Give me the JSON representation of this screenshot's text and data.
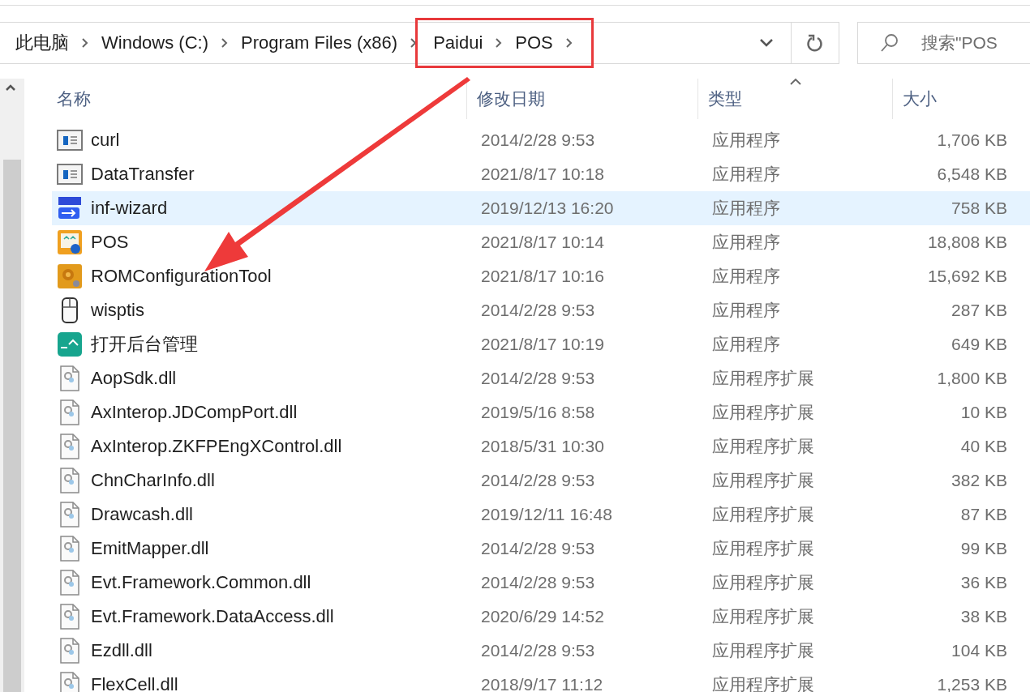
{
  "address_bar": {
    "crumbs": [
      {
        "label": "此电脑",
        "highlighted": false
      },
      {
        "label": "Windows (C:)",
        "highlighted": false
      },
      {
        "label": "Program Files (x86)",
        "highlighted": false
      },
      {
        "label": "Paidui",
        "highlighted": true
      },
      {
        "label": "POS",
        "highlighted": true
      }
    ]
  },
  "search": {
    "placeholder": "搜索\"POS"
  },
  "columns": [
    {
      "label": "名称",
      "sorted": false
    },
    {
      "label": "修改日期",
      "sorted": false
    },
    {
      "label": "类型",
      "sorted": true
    },
    {
      "label": "大小",
      "sorted": false
    }
  ],
  "files": [
    {
      "kind": "app-window",
      "name": "curl",
      "modified": "2014/2/28 9:53",
      "type": "应用程序",
      "size": "1,706 KB",
      "selected": false
    },
    {
      "kind": "app-window",
      "name": "DataTransfer",
      "modified": "2021/8/17 10:18",
      "type": "应用程序",
      "size": "6,548 KB",
      "selected": false
    },
    {
      "kind": "usb-app",
      "name": "inf-wizard",
      "modified": "2019/12/13 16:20",
      "type": "应用程序",
      "size": "758 KB",
      "selected": true
    },
    {
      "kind": "pos-app",
      "name": "POS",
      "modified": "2021/8/17 10:14",
      "type": "应用程序",
      "size": "18,808 KB",
      "selected": false
    },
    {
      "kind": "gear-app",
      "name": "ROMConfigurationTool",
      "modified": "2021/8/17 10:16",
      "type": "应用程序",
      "size": "15,692 KB",
      "selected": false
    },
    {
      "kind": "mouse-app",
      "name": "wisptis",
      "modified": "2014/2/28 9:53",
      "type": "应用程序",
      "size": "287 KB",
      "selected": false
    },
    {
      "kind": "teal-app",
      "name": "打开后台管理",
      "modified": "2021/8/17 10:19",
      "type": "应用程序",
      "size": "649 KB",
      "selected": false
    },
    {
      "kind": "dll",
      "name": "AopSdk.dll",
      "modified": "2014/2/28 9:53",
      "type": "应用程序扩展",
      "size": "1,800 KB",
      "selected": false
    },
    {
      "kind": "dll",
      "name": "AxInterop.JDCompPort.dll",
      "modified": "2019/5/16 8:58",
      "type": "应用程序扩展",
      "size": "10 KB",
      "selected": false
    },
    {
      "kind": "dll",
      "name": "AxInterop.ZKFPEngXControl.dll",
      "modified": "2018/5/31 10:30",
      "type": "应用程序扩展",
      "size": "40 KB",
      "selected": false
    },
    {
      "kind": "dll",
      "name": "ChnCharInfo.dll",
      "modified": "2014/2/28 9:53",
      "type": "应用程序扩展",
      "size": "382 KB",
      "selected": false
    },
    {
      "kind": "dll",
      "name": "Drawcash.dll",
      "modified": "2019/12/11 16:48",
      "type": "应用程序扩展",
      "size": "87 KB",
      "selected": false
    },
    {
      "kind": "dll",
      "name": "EmitMapper.dll",
      "modified": "2014/2/28 9:53",
      "type": "应用程序扩展",
      "size": "99 KB",
      "selected": false
    },
    {
      "kind": "dll",
      "name": "Evt.Framework.Common.dll",
      "modified": "2014/2/28 9:53",
      "type": "应用程序扩展",
      "size": "36 KB",
      "selected": false
    },
    {
      "kind": "dll",
      "name": "Evt.Framework.DataAccess.dll",
      "modified": "2020/6/29 14:52",
      "type": "应用程序扩展",
      "size": "38 KB",
      "selected": false
    },
    {
      "kind": "dll",
      "name": "Ezdll.dll",
      "modified": "2014/2/28 9:53",
      "type": "应用程序扩展",
      "size": "104 KB",
      "selected": false
    },
    {
      "kind": "dll",
      "name": "FlexCell.dll",
      "modified": "2018/9/17 11:12",
      "type": "应用程序扩展",
      "size": "1,253 KB",
      "selected": false
    }
  ]
}
